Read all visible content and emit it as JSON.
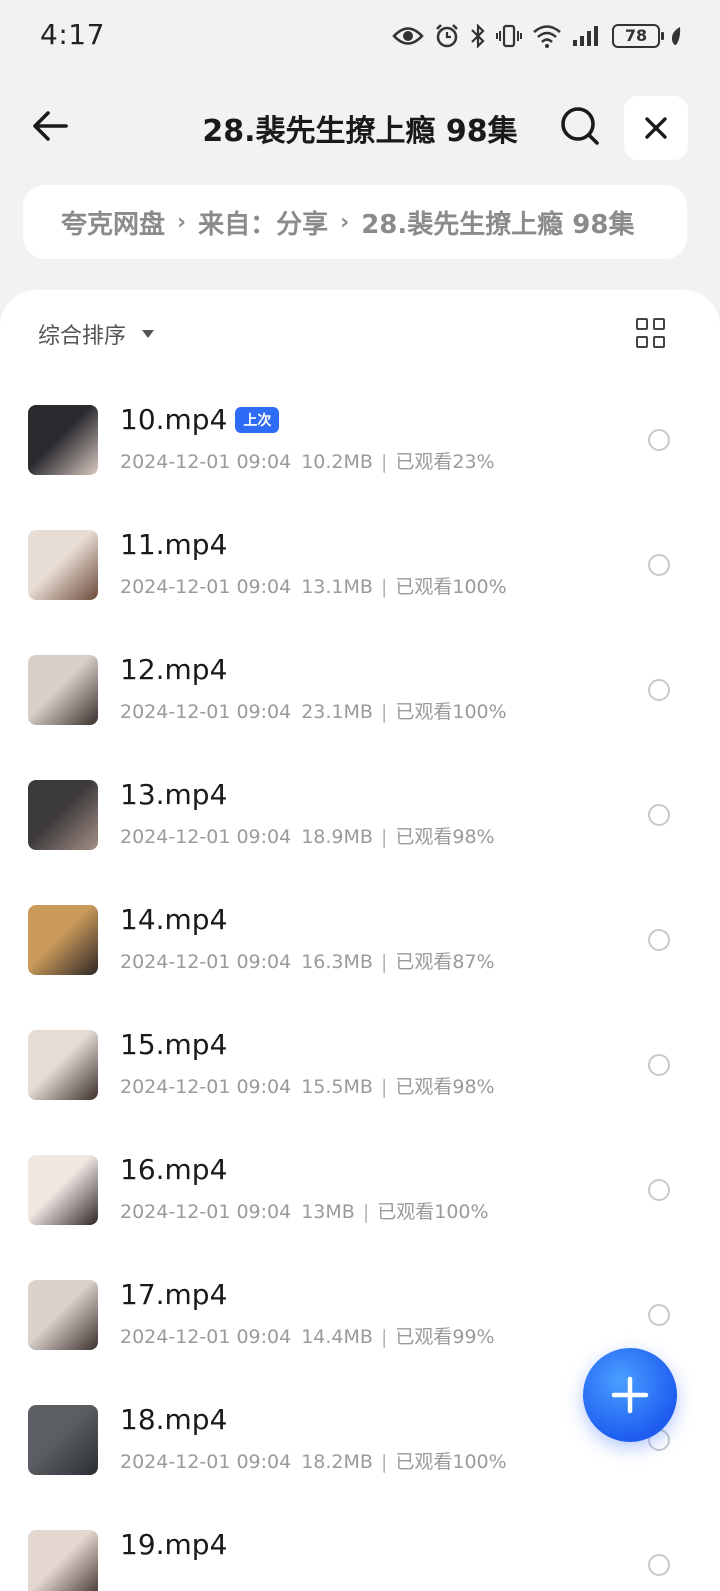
{
  "status_bar": {
    "time": "4:17",
    "battery": "78",
    "icons": [
      "eye-icon",
      "alarm-icon",
      "bluetooth-icon",
      "vibrate-icon",
      "wifi-icon",
      "signal-icon",
      "battery-icon",
      "leaf-icon"
    ]
  },
  "header": {
    "title": "28.裴先生撩上瘾 98集",
    "back_icon": "arrow-left-icon",
    "search_icon": "search-icon",
    "close_icon": "close-icon"
  },
  "breadcrumb": {
    "items": [
      "夸克网盘",
      "来自：分享",
      "28.裴先生撩上瘾 98集"
    ],
    "separator": "›"
  },
  "toolbar": {
    "sort_label": "综合排序",
    "view_icon": "grid-view-icon"
  },
  "files": [
    {
      "name": "10.mp4",
      "date": "2024-12-01 09:04",
      "size": "10.2MB",
      "progress": "已观看23%",
      "badge": "上次",
      "thumb_colors": [
        "#2a2a2e",
        "#d9c9c2"
      ]
    },
    {
      "name": "11.mp4",
      "date": "2024-12-01 09:04",
      "size": "13.1MB",
      "progress": "已观看100%",
      "badge": "",
      "thumb_colors": [
        "#e8ddd4",
        "#6b4a3a"
      ]
    },
    {
      "name": "12.mp4",
      "date": "2024-12-01 09:04",
      "size": "23.1MB",
      "progress": "已观看100%",
      "badge": "",
      "thumb_colors": [
        "#d8cfc9",
        "#3a2f2c"
      ]
    },
    {
      "name": "13.mp4",
      "date": "2024-12-01 09:04",
      "size": "18.9MB",
      "progress": "已观看98%",
      "badge": "",
      "thumb_colors": [
        "#3d3a3c",
        "#a38f86"
      ]
    },
    {
      "name": "14.mp4",
      "date": "2024-12-01 09:04",
      "size": "16.3MB",
      "progress": "已观看87%",
      "badge": "",
      "thumb_colors": [
        "#c99a5a",
        "#2d2626"
      ]
    },
    {
      "name": "15.mp4",
      "date": "2024-12-01 09:04",
      "size": "15.5MB",
      "progress": "已观看98%",
      "badge": "",
      "thumb_colors": [
        "#e6dcd6",
        "#3b2e2b"
      ]
    },
    {
      "name": "16.mp4",
      "date": "2024-12-01 09:04",
      "size": "13MB",
      "progress": "已观看100%",
      "badge": "",
      "thumb_colors": [
        "#efe7e2",
        "#2e2725"
      ]
    },
    {
      "name": "17.mp4",
      "date": "2024-12-01 09:04",
      "size": "14.4MB",
      "progress": "已观看99%",
      "badge": "",
      "thumb_colors": [
        "#dcd2cc",
        "#3a302d"
      ]
    },
    {
      "name": "18.mp4",
      "date": "2024-12-01 09:04",
      "size": "18.2MB",
      "progress": "已观看100%",
      "badge": "",
      "thumb_colors": [
        "#5b5e63",
        "#2a2d33"
      ]
    },
    {
      "name": "19.mp4",
      "date": "",
      "size": "",
      "progress": "",
      "badge": "",
      "thumb_colors": [
        "#e3d7d0",
        "#3b2e2a"
      ]
    }
  ],
  "fab": {
    "icon": "plus-icon"
  },
  "colors": {
    "accent": "#2f6cf5",
    "background": "#f2f2f4",
    "meta_text": "#9a9a9d"
  }
}
